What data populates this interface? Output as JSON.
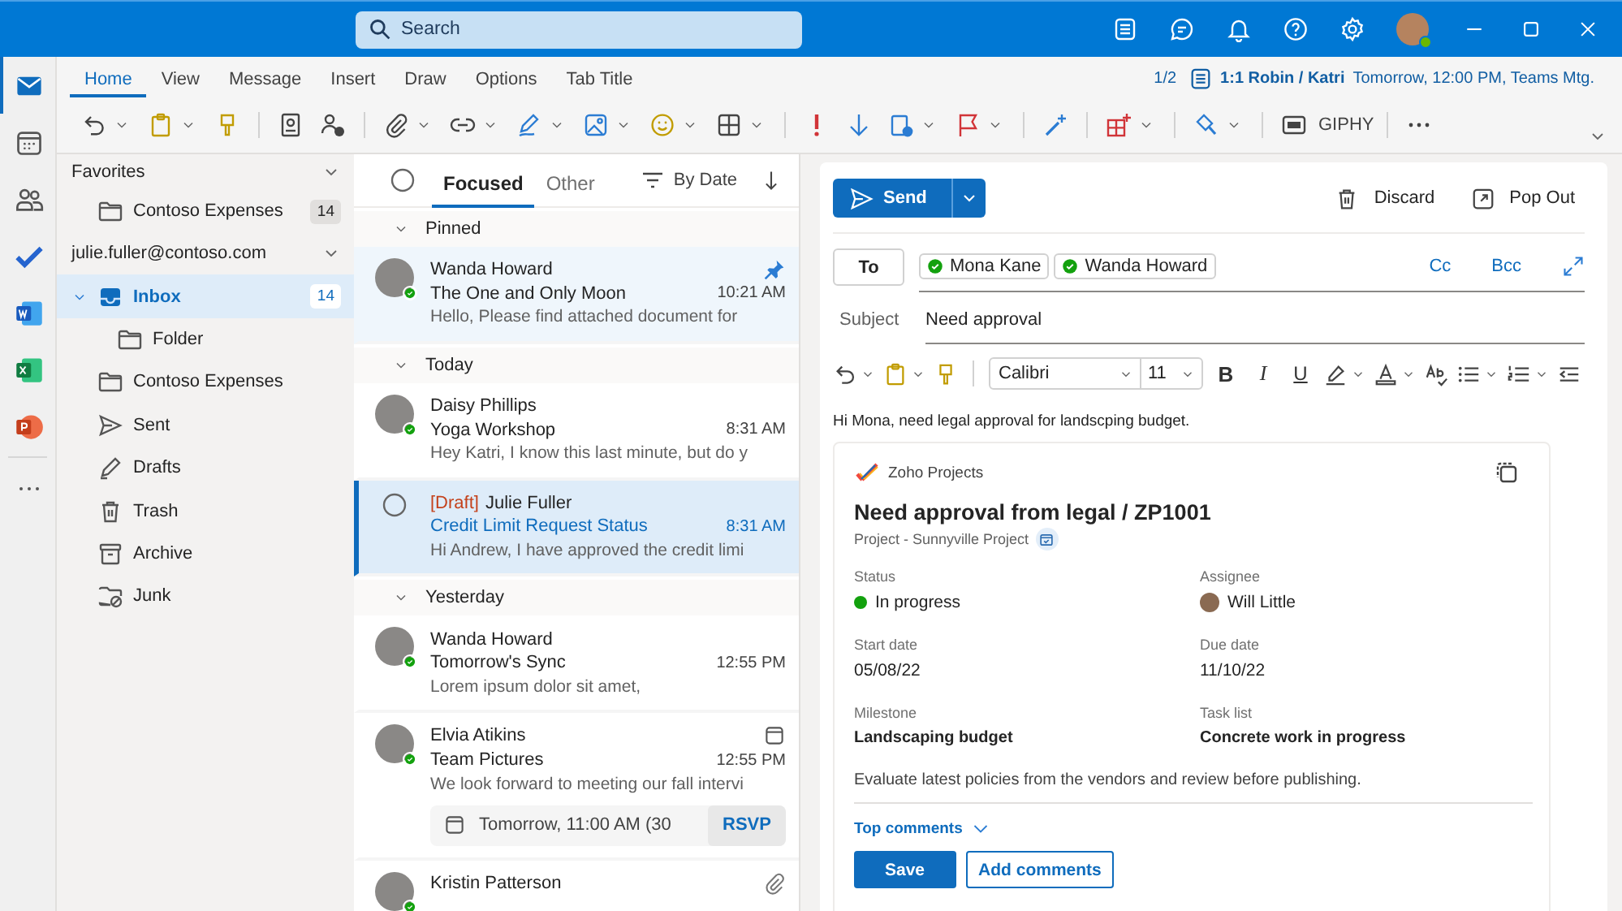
{
  "search": {
    "placeholder": "Search"
  },
  "app_rail": [
    {
      "kind": "mail",
      "selected": true
    },
    {
      "kind": "calendar",
      "selected": false
    },
    {
      "kind": "people",
      "selected": false
    },
    {
      "kind": "todo",
      "selected": false
    },
    {
      "kind": "word",
      "selected": false
    },
    {
      "kind": "excel",
      "selected": false
    },
    {
      "kind": "powerpoint",
      "selected": false
    },
    {
      "kind": "more",
      "selected": false
    }
  ],
  "ribbon": {
    "tabs": [
      {
        "label": "Home",
        "selected": true
      },
      {
        "label": "View",
        "selected": false
      },
      {
        "label": "Message",
        "selected": false
      },
      {
        "label": "Insert",
        "selected": false
      },
      {
        "label": "Draw",
        "selected": false
      },
      {
        "label": "Options",
        "selected": false
      },
      {
        "label": "Tab Title",
        "selected": false
      }
    ],
    "meeting": {
      "counter": "1/2",
      "title": "1:1 Robin / Katri",
      "detail": "Tomorrow, 12:00 PM, Teams Mtg."
    },
    "giphy_label": "GIPHY"
  },
  "folder_pane": {
    "sections": [
      {
        "title": "Favorites",
        "items": [
          {
            "label": "Contoso Expenses",
            "kind": "folder",
            "count": "14",
            "selected": false
          }
        ]
      },
      {
        "title": "julie.fuller@contoso.com",
        "items": [
          {
            "label": "Inbox",
            "kind": "inbox",
            "count": "14",
            "selected": true,
            "expanded": true,
            "children": [
              {
                "label": "Folder",
                "kind": "folder",
                "selected": false
              }
            ]
          },
          {
            "label": "Contoso Expenses",
            "kind": "folder",
            "selected": false
          },
          {
            "label": "Sent",
            "kind": "sent",
            "selected": false
          },
          {
            "label": "Drafts",
            "kind": "drafts",
            "selected": false
          },
          {
            "label": "Trash",
            "kind": "trash",
            "selected": false
          },
          {
            "label": "Archive",
            "kind": "archive",
            "selected": false
          },
          {
            "label": "Junk",
            "kind": "junk",
            "selected": false
          }
        ]
      }
    ]
  },
  "message_list": {
    "tabs": [
      {
        "label": "Focused",
        "selected": true
      },
      {
        "label": "Other",
        "selected": false
      }
    ],
    "sort_label": "By Date",
    "groups": [
      {
        "title": "Pinned",
        "messages": [
          {
            "sender": "Wanda Howard",
            "subject": "The One and Only Moon",
            "time": "10:21 AM",
            "preview": "Hello, Please find attached document for",
            "kind": "message",
            "pinned": true,
            "selected": false
          }
        ]
      },
      {
        "title": "Today",
        "messages": [
          {
            "sender": "Daisy Phillips",
            "subject": "Yoga Workshop",
            "time": "8:31 AM",
            "preview": "Hey Katri, I know this last minute, but do y",
            "kind": "message",
            "pinned": false,
            "selected": false
          },
          {
            "draft_label": "[Draft]",
            "sender": "Julie Fuller",
            "subject": "Credit Limit Request Status",
            "time": "8:31 AM",
            "preview": "Hi Andrew, I have approved the credit limi",
            "kind": "message",
            "pinned": false,
            "selected": true
          }
        ]
      },
      {
        "title": "Yesterday",
        "messages": [
          {
            "sender": "Wanda Howard",
            "subject": "Tomorrow's Sync",
            "time": "12:55 PM",
            "preview": "Lorem ipsum dolor sit amet,",
            "kind": "message",
            "pinned": false,
            "selected": false
          },
          {
            "sender": "Elvia Atikins",
            "kind": "invite",
            "subject": "Team Pictures",
            "time": "12:55 PM",
            "preview": "We look forward to meeting our fall intervi",
            "event": {
              "text": "Tomorrow, 11:00 AM (30",
              "action": "RSVP"
            },
            "pinned": false,
            "selected": false
          },
          {
            "sender": "Kristin Patterson",
            "kind": "attachment",
            "pinned": false,
            "selected": false
          }
        ]
      }
    ]
  },
  "compose": {
    "send_label": "Send",
    "actions": [
      {
        "label": "Discard",
        "kind": "discard"
      },
      {
        "label": "Pop Out",
        "kind": "popout"
      }
    ],
    "to_label": "To",
    "recipients": [
      {
        "name": "Mona Kane"
      },
      {
        "name": "Wanda Howard"
      }
    ],
    "cc_label": "Cc",
    "bcc_label": "Bcc",
    "subject_label": "Subject",
    "subject": "Need approval",
    "font": "Calibri",
    "size": "11",
    "format_buttons": [
      {
        "kind": "bold",
        "symbol": "B"
      },
      {
        "kind": "italic",
        "symbol": "I"
      },
      {
        "kind": "underline",
        "symbol": "U"
      }
    ],
    "body": "Hi Mona, need legal approval for landscping budget.",
    "card": {
      "app_name": "Zoho Projects",
      "title": "Need approval from legal / ZP1001",
      "subtitle": "Project - Sunnyville Project",
      "fields": [
        {
          "label": "Status",
          "value": "In progress",
          "kind": "status",
          "color": "#13a10e"
        },
        {
          "label": "Assignee",
          "value": "Will Little",
          "kind": "person"
        },
        {
          "label": "Start date",
          "value": "05/08/22",
          "kind": "text"
        },
        {
          "label": "Due date",
          "value": "11/10/22",
          "kind": "text"
        },
        {
          "label": "Milestone",
          "value": "Landscaping budget",
          "kind": "strong"
        },
        {
          "label": "Task list",
          "value": "Concrete work in progress",
          "kind": "strong"
        }
      ],
      "description": "Evaluate latest policies from the vendors and review before publishing.",
      "comments_toggle": "Top comments",
      "buttons": [
        {
          "label": "Save",
          "kind": "primary"
        },
        {
          "label": "Add comments",
          "kind": "secondary"
        }
      ]
    }
  }
}
